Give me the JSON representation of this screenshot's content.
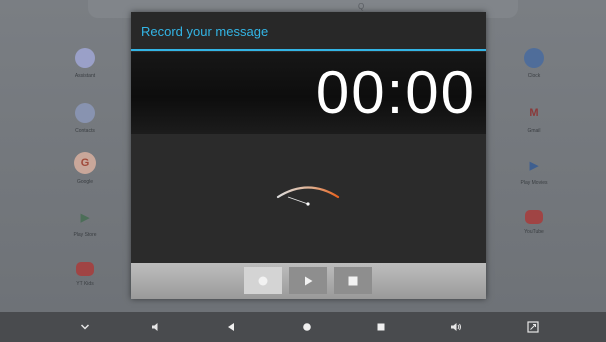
{
  "launcher": {
    "search_label": "Q",
    "left_apps": [
      {
        "label": "Assistant",
        "glyph": "",
        "color": "#4285f4"
      },
      {
        "label": "Contacts",
        "glyph": "",
        "color": "#1a73e8"
      },
      {
        "label": "Google",
        "glyph": "G",
        "color": "#ea4335"
      },
      {
        "label": "Play Store",
        "glyph": "▶",
        "color": "#34a853"
      },
      {
        "label": "YT Kids",
        "glyph": "",
        "color": "#e53935"
      }
    ],
    "right_apps": [
      {
        "label": "Clock",
        "glyph": "",
        "color": "#1a73e8"
      },
      {
        "label": "Gmail",
        "glyph": "M",
        "color": "#ea4335"
      },
      {
        "label": "Play Movies",
        "glyph": "▶",
        "color": "#1a73e8"
      },
      {
        "label": "YouTube",
        "glyph": "",
        "color": "#e53935"
      }
    ]
  },
  "dialog": {
    "title": "Record your message",
    "timer": "00:00",
    "accent_color": "#33b5e5"
  },
  "controls": {
    "record_icon": "record-icon",
    "play_icon": "play-icon",
    "stop_icon": "stop-icon"
  },
  "navbar": {
    "icons": [
      "chevron-down-icon",
      "volume-down-icon",
      "back-icon",
      "home-icon",
      "recents-icon",
      "volume-up-icon",
      "screenshot-icon"
    ]
  }
}
